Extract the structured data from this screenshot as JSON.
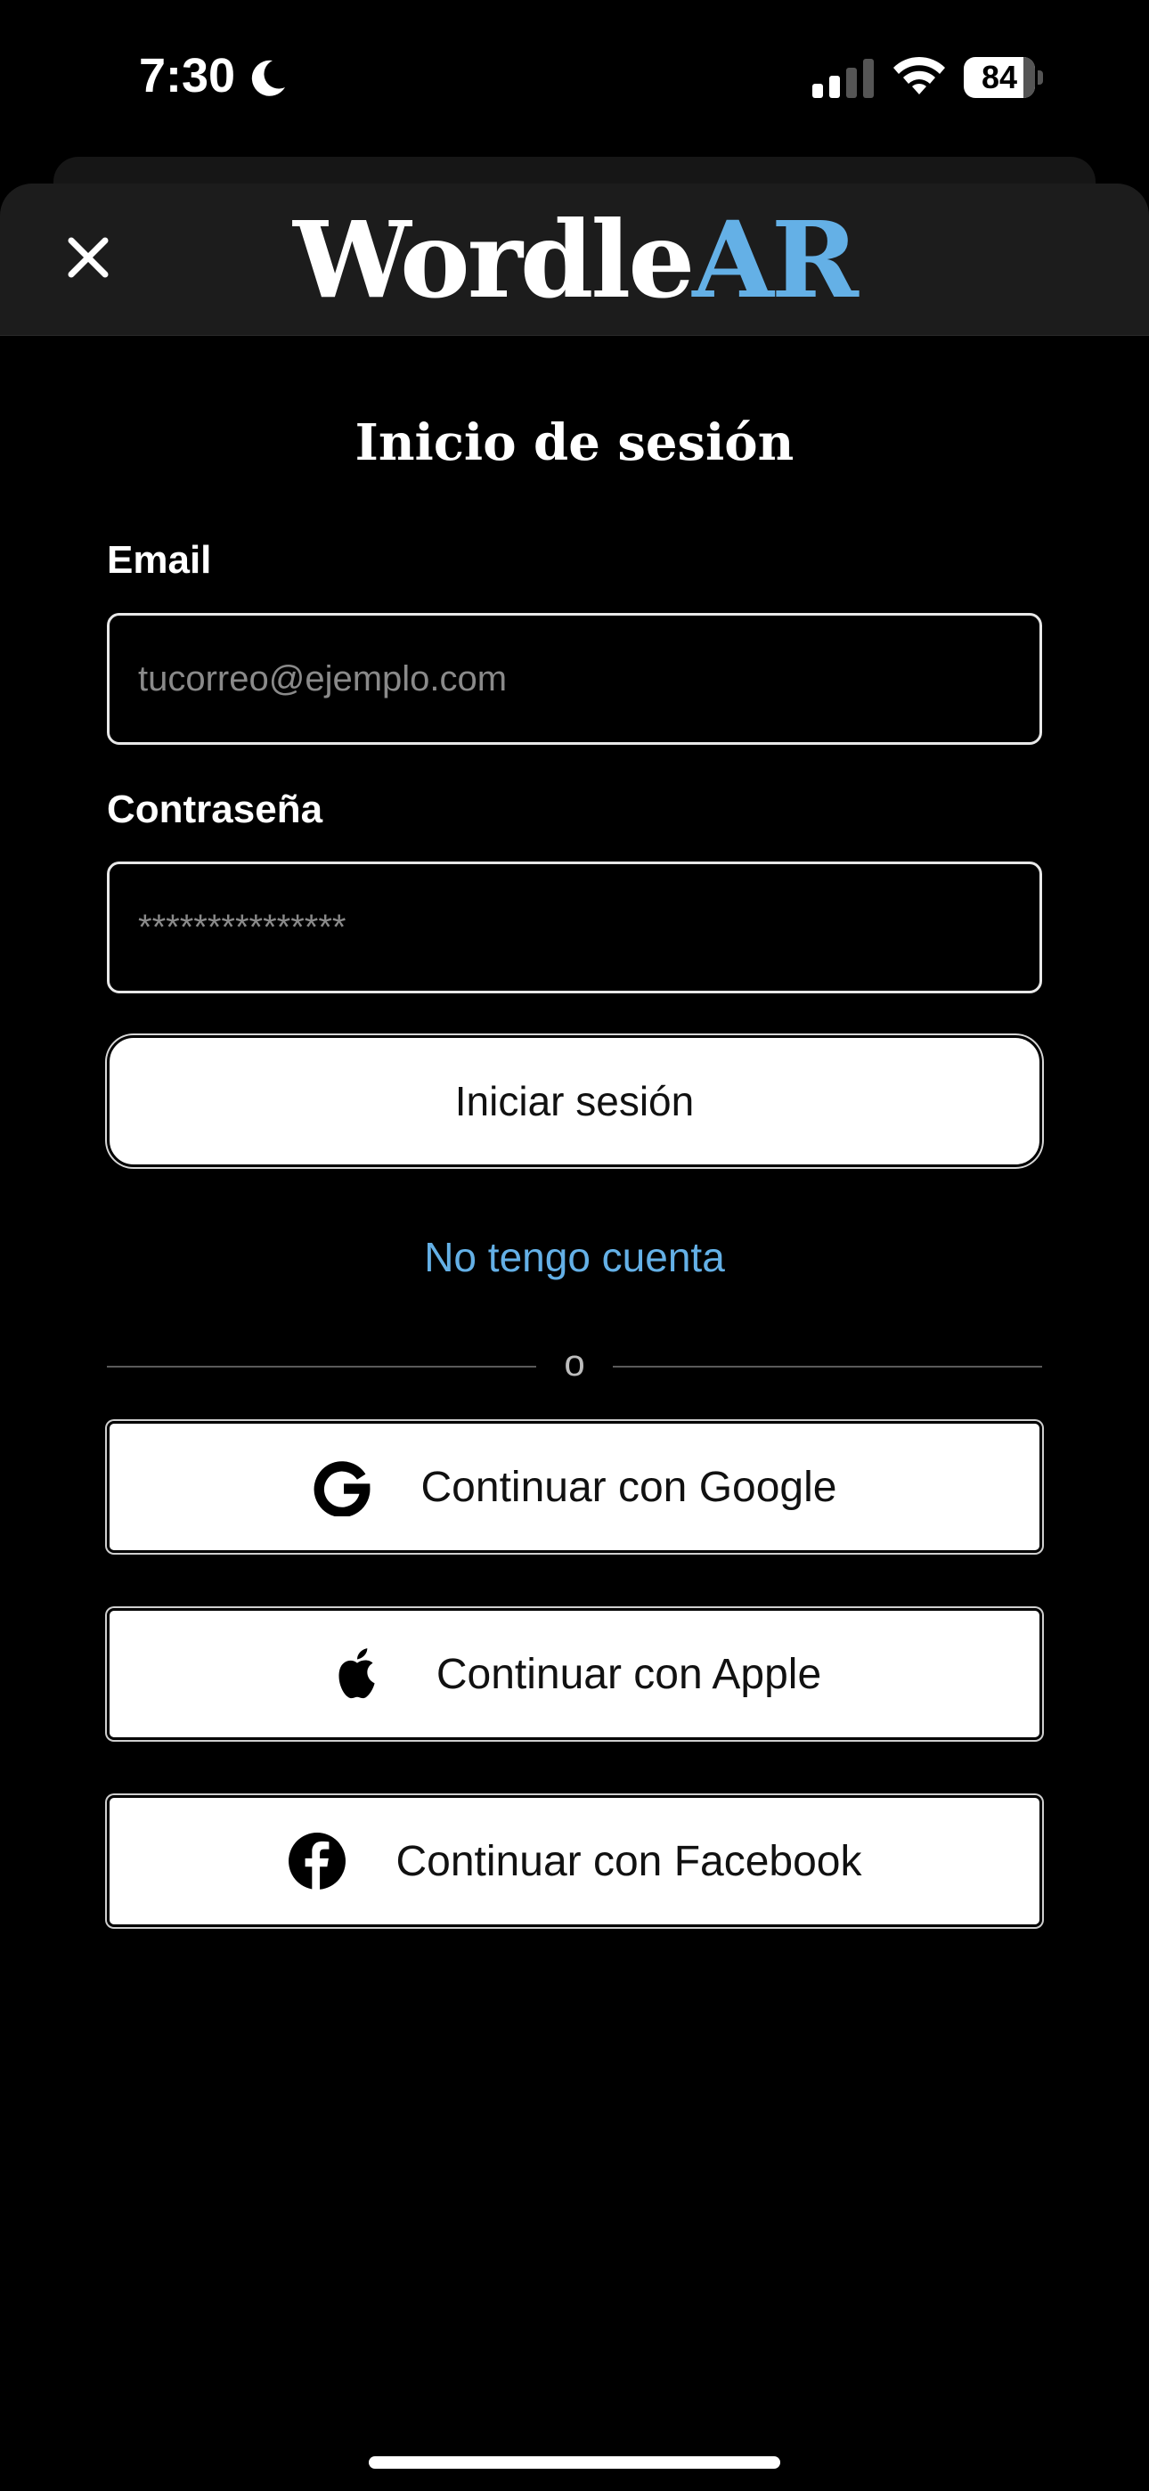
{
  "status_bar": {
    "time": "7:30",
    "battery_level": "84",
    "battery_fraction": 0.84
  },
  "header": {
    "brand_word": "Wordle",
    "brand_accent": "AR",
    "accent_color": "#64b0e6",
    "close_icon": "close-icon"
  },
  "login": {
    "title": "Inicio de sesión",
    "email_label": "Email",
    "email_placeholder": "tucorreo@ejemplo.com",
    "email_value": "",
    "password_label": "Contraseña",
    "password_placeholder": "***************",
    "password_value": "",
    "submit_label": "Iniciar sesión",
    "signup_link": "No tengo cuenta",
    "divider_text": "o"
  },
  "social": {
    "google_label": "Continuar con Google",
    "apple_label": "Continuar con Apple",
    "facebook_label": "Continuar con Facebook"
  }
}
